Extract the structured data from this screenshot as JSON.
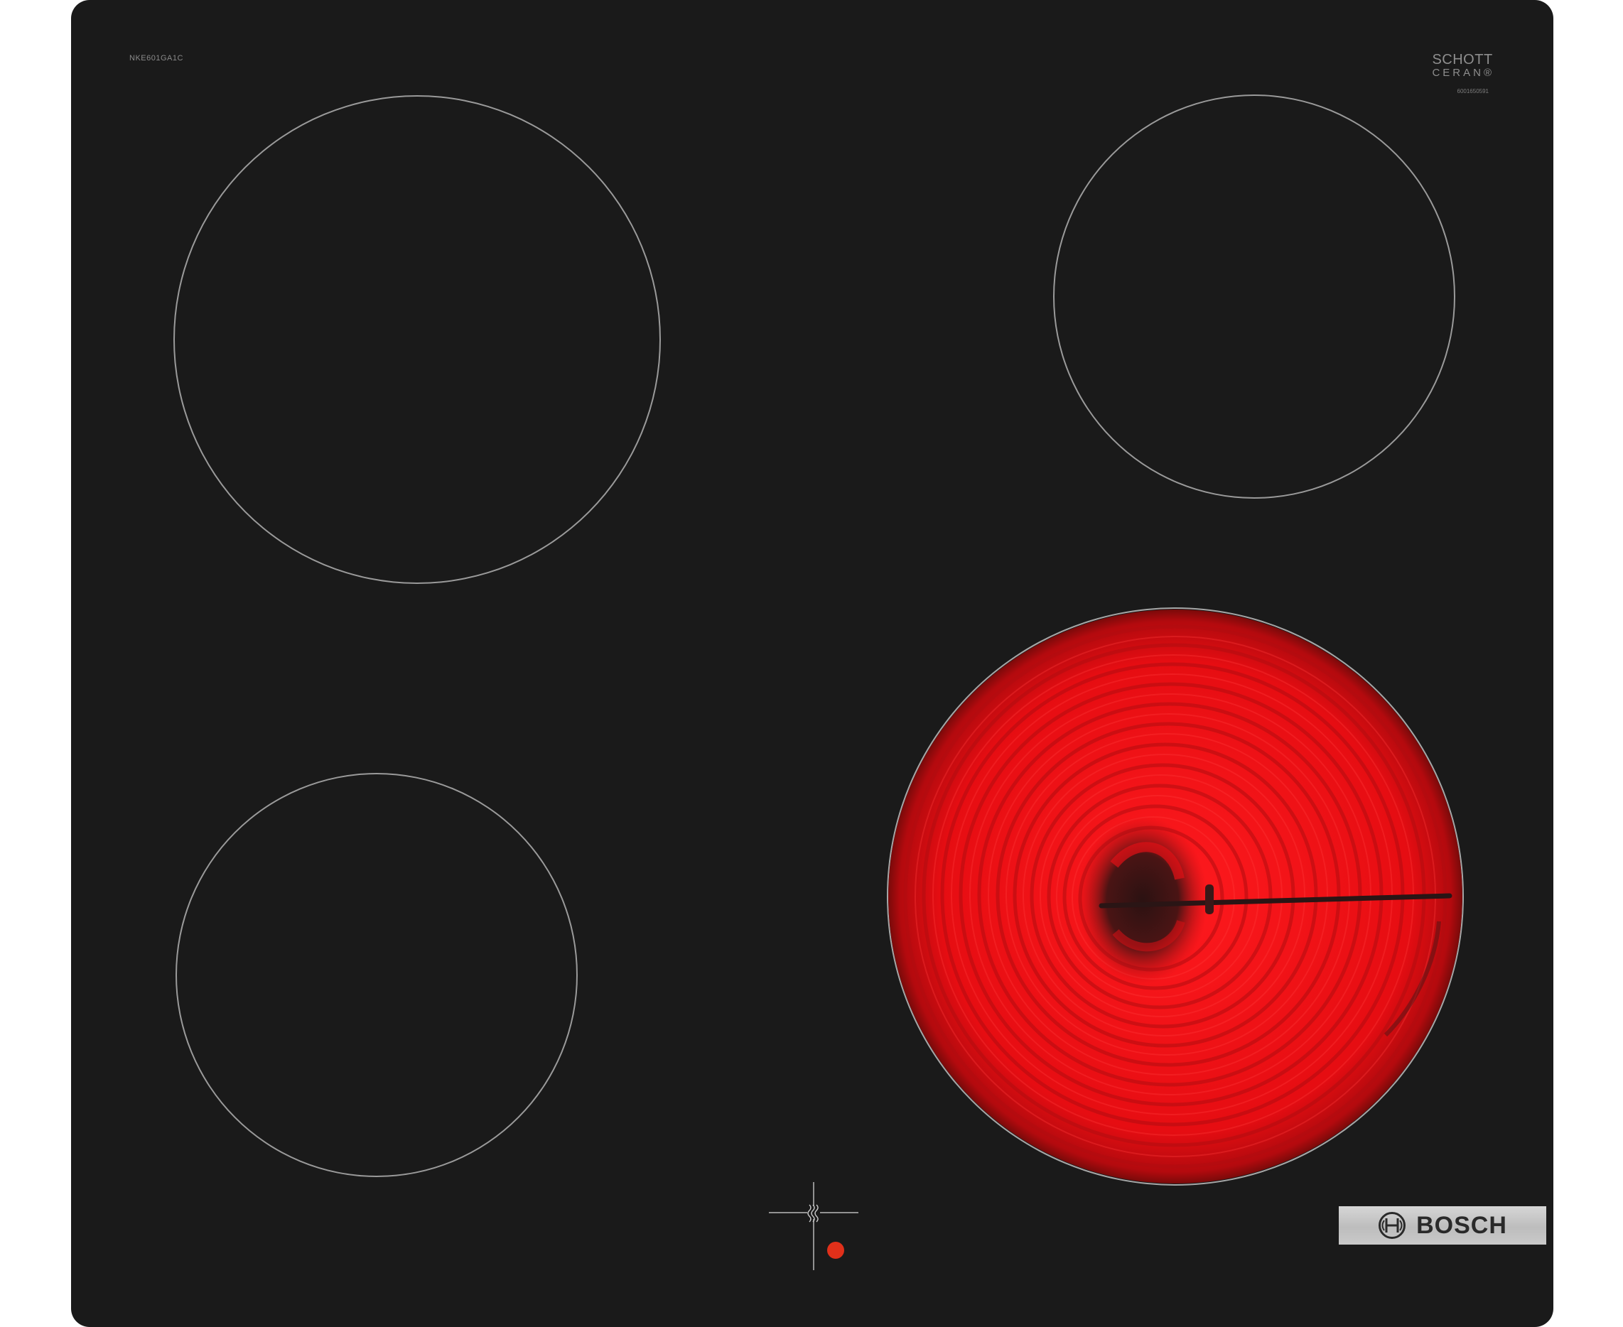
{
  "product": {
    "model_code": "NKE601GA1C",
    "glass_brand_line1": "SCHOTT",
    "glass_brand_line2": "CERAN®",
    "glass_serial": "6001650591",
    "brand": "BOSCH"
  },
  "colors": {
    "glass": "#1a1a1a",
    "zone_outline": "#9a9a9a",
    "heat_red": "#e50d12",
    "indicator": "#e0301a"
  },
  "zones": [
    {
      "position": "top-left",
      "state": "off"
    },
    {
      "position": "top-right",
      "state": "off"
    },
    {
      "position": "bottom-left",
      "state": "off"
    },
    {
      "position": "bottom-right",
      "state": "glowing"
    }
  ],
  "controls": {
    "icon": "heat-zone-indicator-icon",
    "indicator_state": "on"
  }
}
